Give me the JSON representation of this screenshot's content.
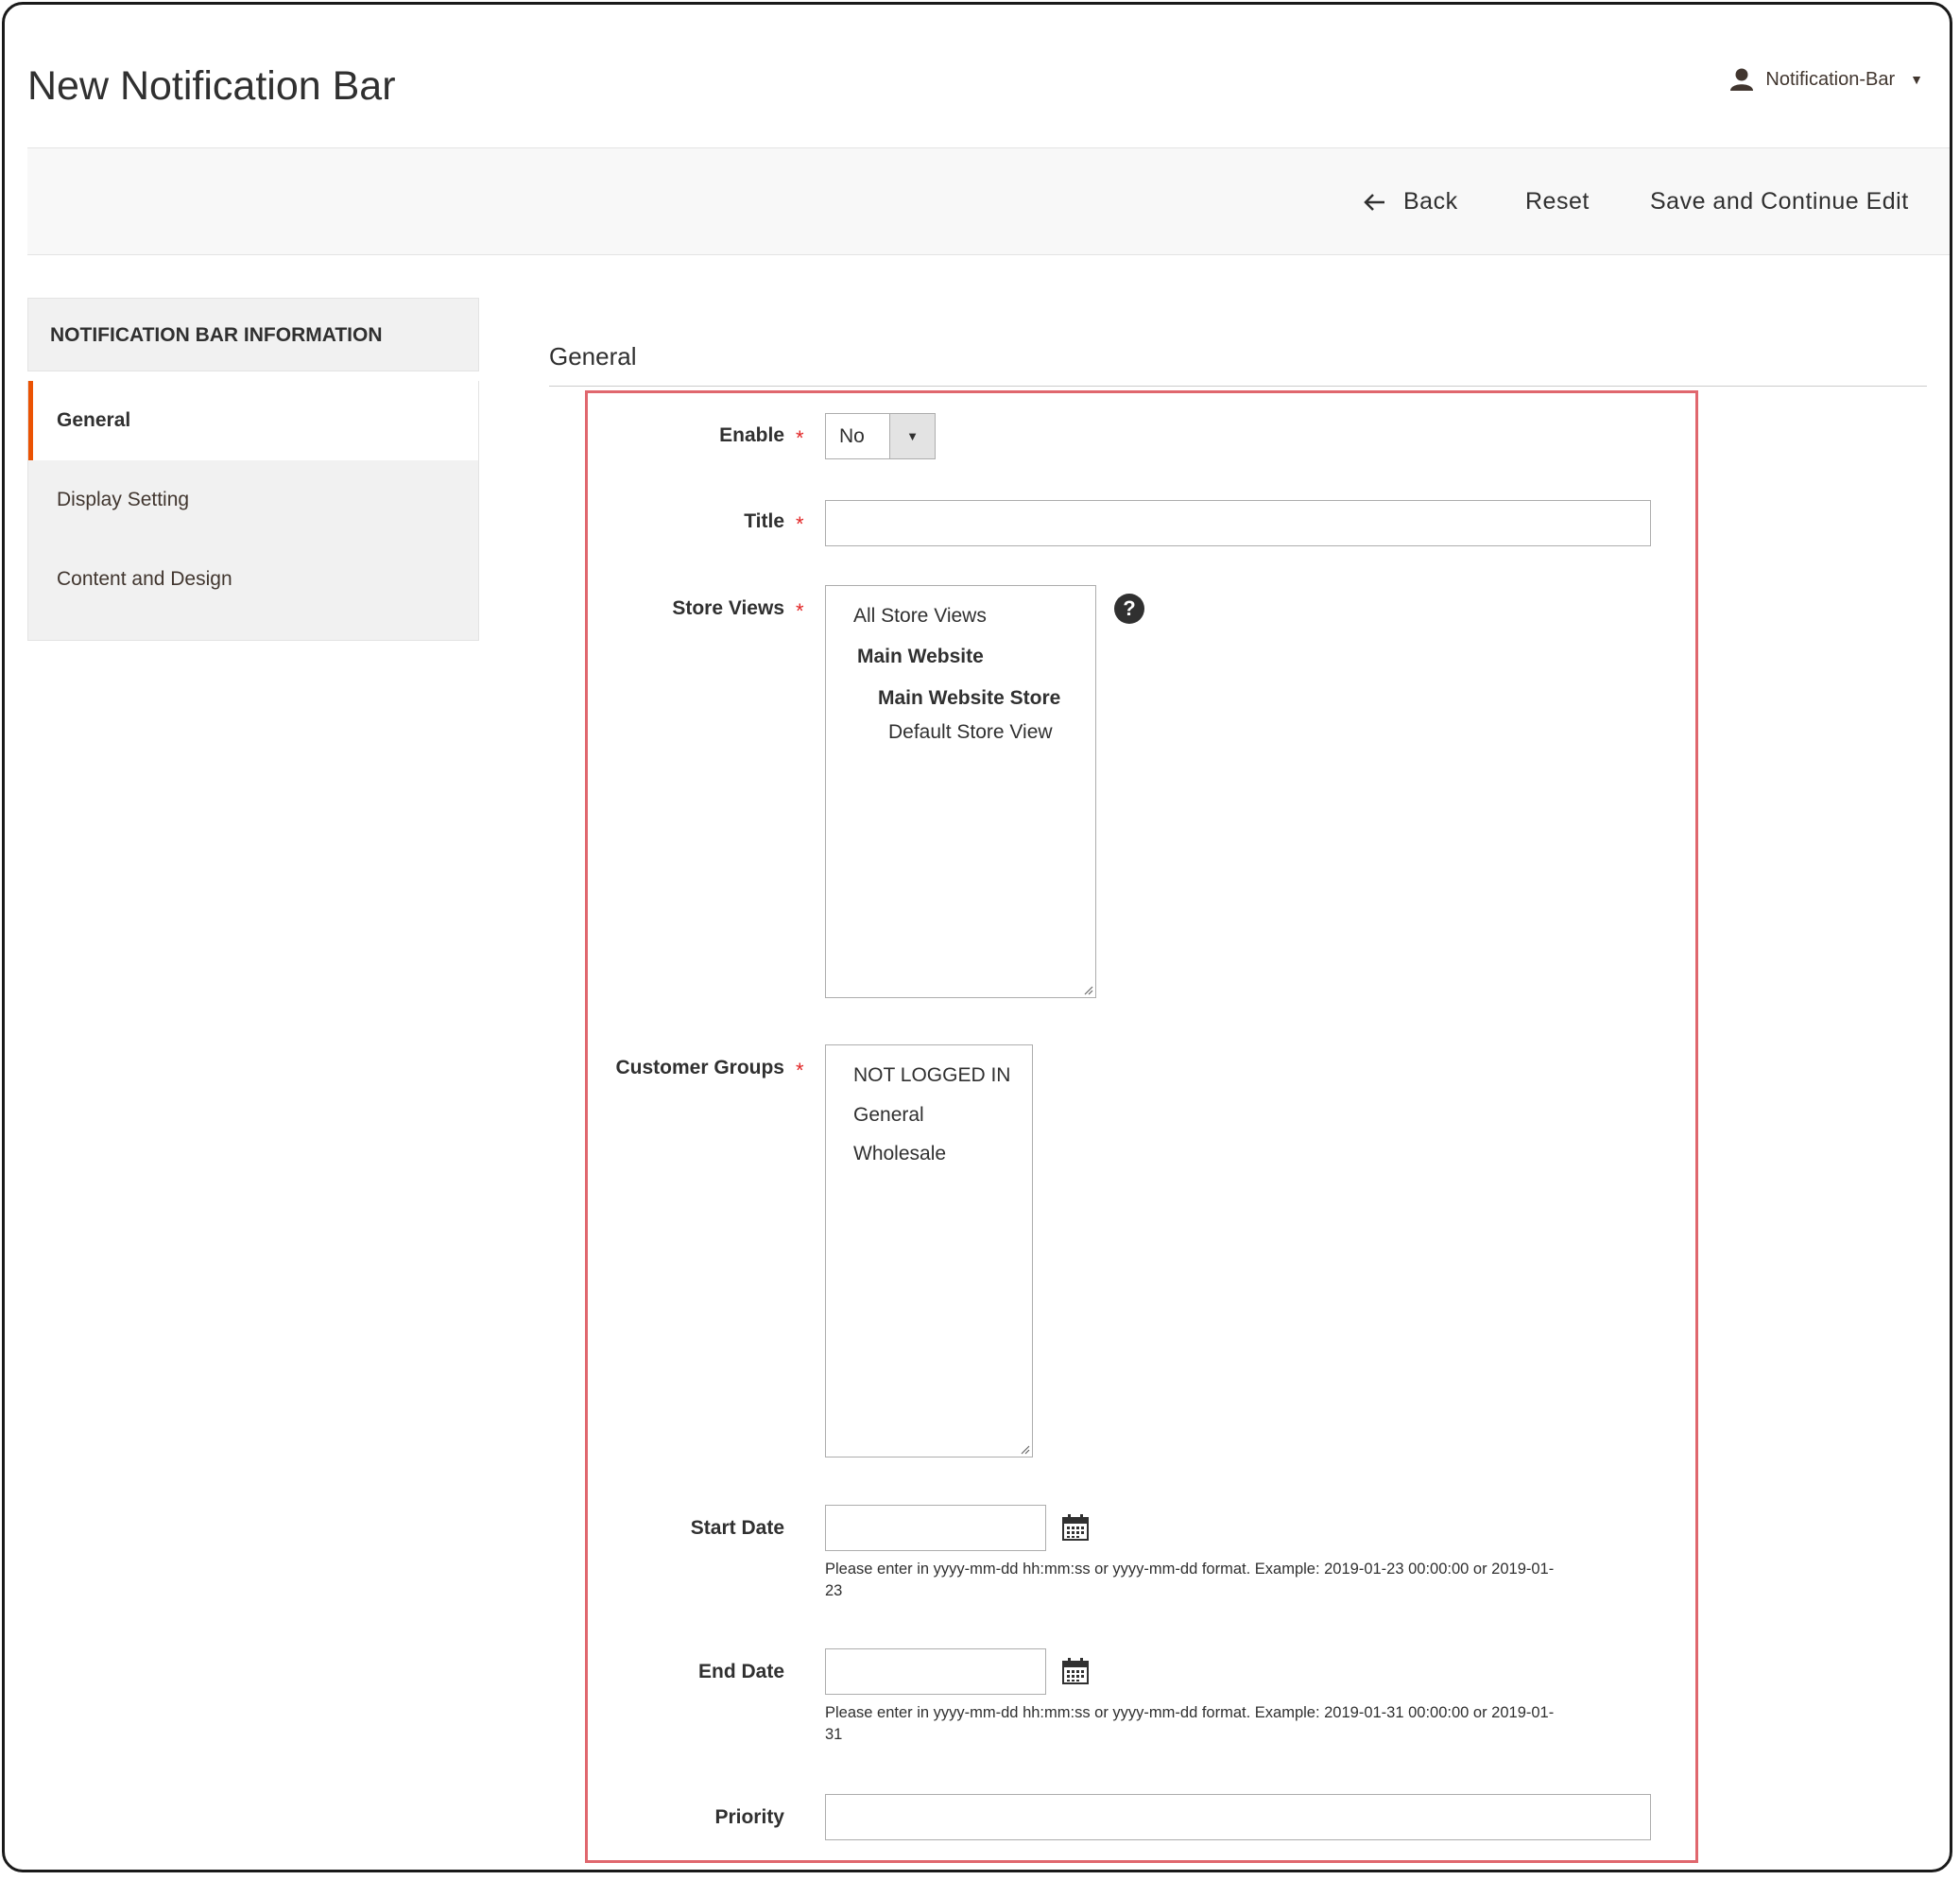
{
  "header": {
    "page_title": "New Notification Bar",
    "account_name": "Notification-Bar"
  },
  "toolbar": {
    "back_label": "Back",
    "reset_label": "Reset",
    "save_continue_label": "Save and Continue Edit"
  },
  "sidebar": {
    "heading": "NOTIFICATION BAR INFORMATION",
    "items": [
      {
        "label": "General",
        "active": true
      },
      {
        "label": "Display Setting",
        "active": false
      },
      {
        "label": "Content and Design",
        "active": false
      }
    ]
  },
  "form": {
    "section_title": "General",
    "required_mark": "*",
    "enable": {
      "label": "Enable",
      "value": "No"
    },
    "title": {
      "label": "Title",
      "value": ""
    },
    "store_views": {
      "label": "Store Views",
      "help": "?",
      "options": [
        "All Store Views",
        "Main Website",
        "Main Website Store",
        "Default Store View"
      ]
    },
    "customer_groups": {
      "label": "Customer Groups",
      "options": [
        "NOT LOGGED IN",
        "General",
        "Wholesale"
      ]
    },
    "start_date": {
      "label": "Start Date",
      "value": "",
      "note_line1": "Please enter in yyyy-mm-dd hh:mm:ss or yyyy-mm-dd format. Example: 2019-01-23 00:00:00 or 2019-01-",
      "note_line2": "23"
    },
    "end_date": {
      "label": "End Date",
      "value": "",
      "note_line1": "Please enter in yyyy-mm-dd hh:mm:ss or yyyy-mm-dd format. Example: 2019-01-31 00:00:00 or 2019-01-",
      "note_line2": "31"
    },
    "priority": {
      "label": "Priority",
      "value": ""
    }
  },
  "colors": {
    "accent": "#eb5202",
    "required": "#e22626",
    "highlight_border": "#e0676e"
  }
}
